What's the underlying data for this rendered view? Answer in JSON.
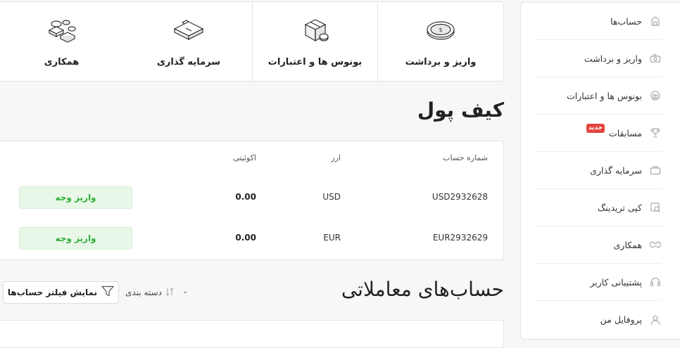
{
  "sidebar": {
    "items": [
      {
        "label": "حساب‌ها",
        "icon": "account-house-icon"
      },
      {
        "label": "واریز و برداشت",
        "icon": "wallet-money-icon"
      },
      {
        "label": "بونوس ها و اعتبارات",
        "icon": "gift-icon"
      },
      {
        "label": "مسابقات",
        "icon": "trophy-icon",
        "badge": "جدید"
      },
      {
        "label": "سرمایه گذاری",
        "icon": "briefcase-icon"
      },
      {
        "label": "کپی تریدینگ",
        "icon": "copy-trading-icon"
      },
      {
        "label": "همکاری",
        "icon": "handshake-icon"
      },
      {
        "label": "پشتیبانی کاربر",
        "icon": "headset-icon"
      },
      {
        "label": "پروفایل من",
        "icon": "user-icon"
      }
    ]
  },
  "top_cards": [
    {
      "label": "واریز و برداشت",
      "icon": "coin-icon"
    },
    {
      "label": "بونوس ها و اعتبارات",
      "icon": "gift-box-icon"
    },
    {
      "label": "سرمایه گذاری",
      "icon": "briefcase-icon"
    },
    {
      "label": "همکاری",
      "icon": "partners-icon"
    }
  ],
  "wallet": {
    "title": "کیف پول",
    "columns": {
      "account": "شماره حساب",
      "currency": "ارز",
      "equity": "اکوئیتی"
    },
    "rows": [
      {
        "account": "USD2932628",
        "currency": "USD",
        "equity": "0.00",
        "action": "واریز وجه"
      },
      {
        "account": "EUR2932629",
        "currency": "EUR",
        "equity": "0.00",
        "action": "واریز وجه"
      }
    ]
  },
  "trading": {
    "title": "حساب‌های معاملاتی",
    "filter_label": "نمایش فیلتر حساب‌ها",
    "sort_label": "دسته بندی",
    "sort_caret": "⌄"
  },
  "colors": {
    "accent_green": "#2fae3a",
    "badge_red": "#e2443e",
    "button_bg": "#e8f7e8"
  }
}
